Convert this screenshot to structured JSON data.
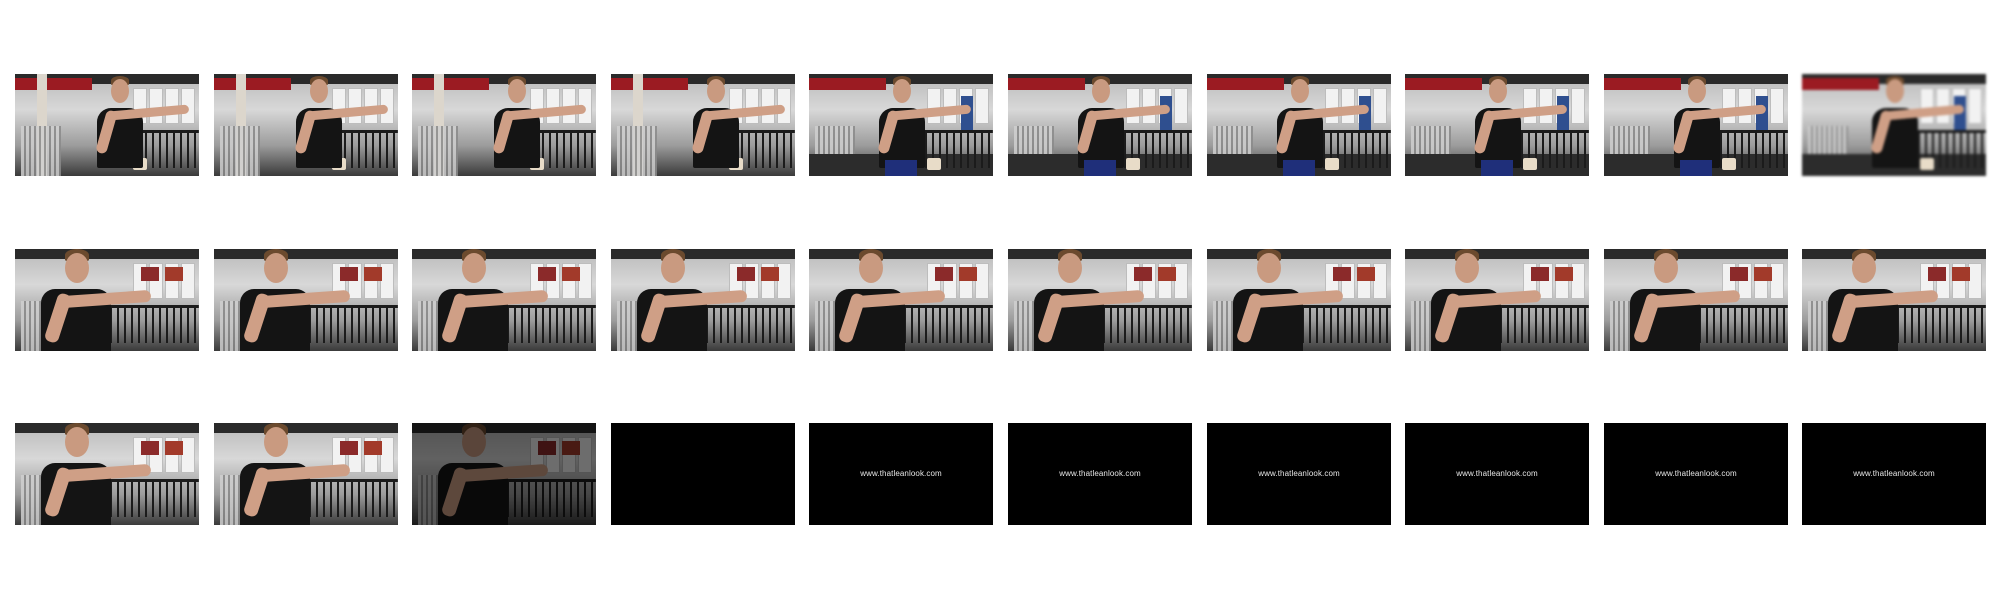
{
  "contact_sheet": {
    "rows": 3,
    "columns": 10,
    "frames": [
      {
        "kind": "gym",
        "view": "wide"
      },
      {
        "kind": "gym",
        "view": "wide"
      },
      {
        "kind": "gym",
        "view": "wide"
      },
      {
        "kind": "gym",
        "view": "wide"
      },
      {
        "kind": "gym",
        "view": "wide-full"
      },
      {
        "kind": "gym",
        "view": "wide-full"
      },
      {
        "kind": "gym",
        "view": "wide-full"
      },
      {
        "kind": "gym",
        "view": "wide-full"
      },
      {
        "kind": "gym",
        "view": "wide-full"
      },
      {
        "kind": "gym",
        "view": "motion-blur"
      },
      {
        "kind": "gym",
        "view": "close"
      },
      {
        "kind": "gym",
        "view": "close"
      },
      {
        "kind": "gym",
        "view": "close"
      },
      {
        "kind": "gym",
        "view": "close"
      },
      {
        "kind": "gym",
        "view": "close"
      },
      {
        "kind": "gym",
        "view": "close"
      },
      {
        "kind": "gym",
        "view": "close"
      },
      {
        "kind": "gym",
        "view": "close"
      },
      {
        "kind": "gym",
        "view": "close"
      },
      {
        "kind": "gym",
        "view": "close"
      },
      {
        "kind": "gym",
        "view": "close"
      },
      {
        "kind": "gym",
        "view": "close"
      },
      {
        "kind": "gym",
        "view": "close-fade"
      },
      {
        "kind": "black",
        "caption": ""
      },
      {
        "kind": "black",
        "caption": "www.thatleanlook.com"
      },
      {
        "kind": "black",
        "caption": "www.thatleanlook.com"
      },
      {
        "kind": "black",
        "caption": "www.thatleanlook.com"
      },
      {
        "kind": "black",
        "caption": "www.thatleanlook.com"
      },
      {
        "kind": "black",
        "caption": "www.thatleanlook.com"
      },
      {
        "kind": "black",
        "caption": "www.thatleanlook.com"
      }
    ]
  },
  "colors": {
    "background": "#ffffff",
    "card_black": "#000000",
    "shirt": "#141414",
    "gym_red": "#9b1b22"
  }
}
